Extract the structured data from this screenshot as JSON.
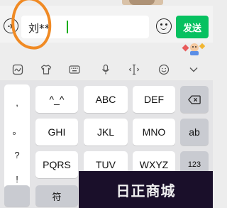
{
  "input": {
    "value": "刘**",
    "send_label": "发送"
  },
  "keyboard": {
    "punctuation": [
      ",",
      "。",
      "?",
      "!"
    ],
    "rows": [
      [
        "^_^",
        "ABC",
        "DEF"
      ],
      [
        "GHI",
        "JKL",
        "MNO"
      ],
      [
        "PQRS",
        "TUV",
        "WXYZ"
      ]
    ],
    "ab_label": "ab",
    "num_label": "123",
    "symbol_label": "符"
  },
  "toolbar": {
    "icons": [
      "handwriting-icon",
      "shirt-icon",
      "keyboard-icon",
      "microphone-icon",
      "cursor-icon",
      "emoji-icon",
      "chevron-down-icon"
    ]
  },
  "watermark": {
    "text": "日正商城"
  },
  "colors": {
    "send": "#07c160",
    "annotation": "#f08a24",
    "caret": "#1aad19"
  }
}
